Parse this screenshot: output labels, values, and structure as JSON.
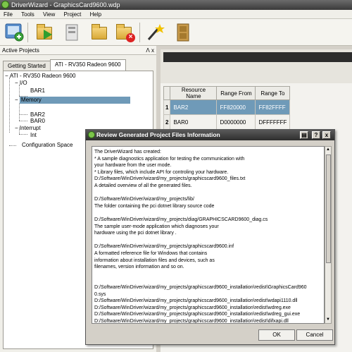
{
  "window": {
    "title": "DriverWizard - GraphicsCard9600.wdp"
  },
  "menu": [
    "File",
    "Tools",
    "View",
    "Project",
    "Help"
  ],
  "toolbar": [
    {
      "name": "new-project-button"
    },
    {
      "name": "open-project-button"
    },
    {
      "name": "save-project-button"
    },
    {
      "name": "open-folder-button"
    },
    {
      "name": "close-project-button"
    },
    {
      "name": "generate-code-button"
    },
    {
      "name": "exit-button"
    }
  ],
  "left_panel": {
    "header": "Active Projects",
    "header_controls": "Ʌ x",
    "tabs": [
      "Getting Started",
      "ATI - RV350 Radeon 9600"
    ],
    "tree": [
      {
        "label": "ATI - RV350 Radeon 9600"
      },
      {
        "label": "I/O"
      },
      {
        "label": "BAR1"
      },
      {
        "label": "Memory"
      },
      {
        "label": "BAR2"
      },
      {
        "label": "BAR0"
      },
      {
        "label": "Interrupt"
      },
      {
        "label": "Int"
      },
      {
        "label": "Configuration Space"
      }
    ]
  },
  "resources": {
    "headers": [
      "Resource Name",
      "Range From",
      "Range To"
    ],
    "rows": [
      {
        "num": "1",
        "name": "BAR2",
        "from": "FF820000",
        "to": "FF82FFFF"
      },
      {
        "num": "2",
        "name": "BAR0",
        "from": "D0000000",
        "to": "DFFFFFFF"
      }
    ]
  },
  "dialog": {
    "title": "Review Generated Project Files Information",
    "lines": [
      "The DriverWizard has created:",
      "* A sample diagnostics application for testing the communication with",
      "  your hardware from the user mode.",
      "* Library files, which include API for controling your hardware.",
      "  D:/Software/WinDriver/wizard/my_projects/graphicscard9600_files.txt",
      "      A detailed overview of all the generated files.",
      "",
      "  D:/Software/WinDriver/wizard/my_projects/lib/",
      "      The folder containing the pci dotnet library source code",
      "",
      "  D:/Software/WinDriver/wizard/my_projects/diag/GRAPHICSCARD9600_diag.cs",
      "      The sample user-mode application which diagnoses your",
      "      hardware using the pci dotnet library .",
      "",
      "  D:/Software/WinDriver/wizard/my_projects/graphicscard9600.inf",
      "      A formatted reference file for Windows that contains",
      "      information about installation files and devices, such as",
      "      filenames, version information and so on.",
      "",
      "",
      "D:/Software/WinDriver/wizard/my_projects/graphicscard9600_installation\\redist\\GraphicsCard960",
      "0.sys",
      "  D:/Software/WinDriver/wizard/my_projects/graphicscard9600_installation\\redist\\wdapi1110.dll",
      "  D:/Software/WinDriver/wizard/my_projects/graphicscard9600_installation\\redist\\wdreg.exe",
      "  D:/Software/WinDriver/wizard/my_projects/graphicscard9600_installation\\redist\\wdreg_gui.exe",
      "  D:/Software/WinDriver/wizard/my_projects/graphicscard9600_installation\\redist\\difxapi.dll"
    ],
    "ok_label": "OK",
    "cancel_label": "Cancel",
    "help_button": "?",
    "close_button": "x"
  }
}
